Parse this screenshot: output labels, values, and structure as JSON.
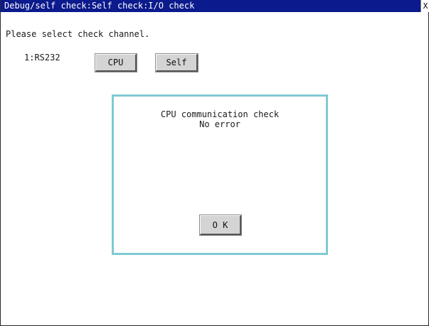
{
  "window": {
    "title": "Debug/self check:Self check:I/O check",
    "close_symbol": "X"
  },
  "prompt": "Please select check channel.",
  "channel_label": "1:RS232",
  "buttons": {
    "cpu": "CPU",
    "self": "Self"
  },
  "dialog": {
    "line1": "CPU communication check",
    "line2": "No error",
    "ok_label": "O K"
  },
  "colors": {
    "titlebar": "#0b1a8c",
    "dialog_border": "#7fcad4",
    "button_face": "#d4d4d4"
  }
}
